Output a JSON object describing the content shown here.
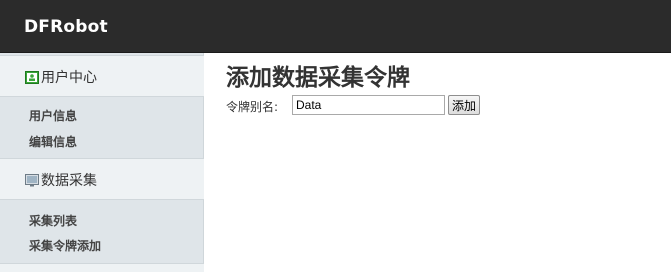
{
  "header": {
    "brand": "DFRobot"
  },
  "sidebar": {
    "sections": [
      {
        "icon": "user-center-icon",
        "label": "用户中心",
        "items": [
          "用户信息",
          "编辑信息"
        ]
      },
      {
        "icon": "data-collection-icon",
        "label": "数据采集",
        "items": [
          "采集列表",
          "采集令牌添加"
        ]
      }
    ]
  },
  "main": {
    "title": "添加数据采集令牌",
    "form": {
      "alias_label": "令牌别名:",
      "alias_value": "Data",
      "submit_label": "添加"
    }
  },
  "colors": {
    "topbar": "#2b2b2b",
    "sidebar": "#dfe5e9",
    "section_header": "#eef2f4",
    "user_icon_green": "#3aa63a"
  }
}
